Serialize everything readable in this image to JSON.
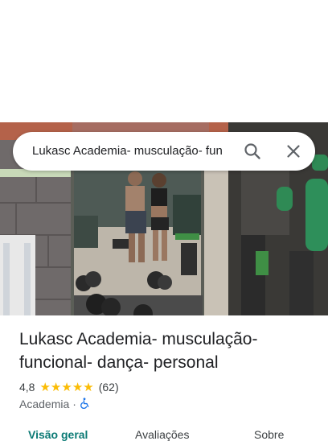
{
  "search": {
    "query": "Lukasc Academia- musculação- fun"
  },
  "place": {
    "name": "Lukasc Academia- musculação- funcional- dança- personal",
    "rating": "4,8",
    "stars": [
      "★",
      "★",
      "★",
      "★",
      "★"
    ],
    "review_count": "(62)",
    "category": "Academia",
    "separator": "·",
    "accessibility_icon": "wheelchair-icon"
  },
  "tabs": [
    {
      "label": "Visão geral",
      "active": true
    },
    {
      "label": "Avaliações",
      "active": false
    },
    {
      "label": "Sobre",
      "active": false
    }
  ],
  "colors": {
    "accent": "#0b7a75",
    "star": "#fbbc04",
    "accessibility": "#1a73e8"
  }
}
